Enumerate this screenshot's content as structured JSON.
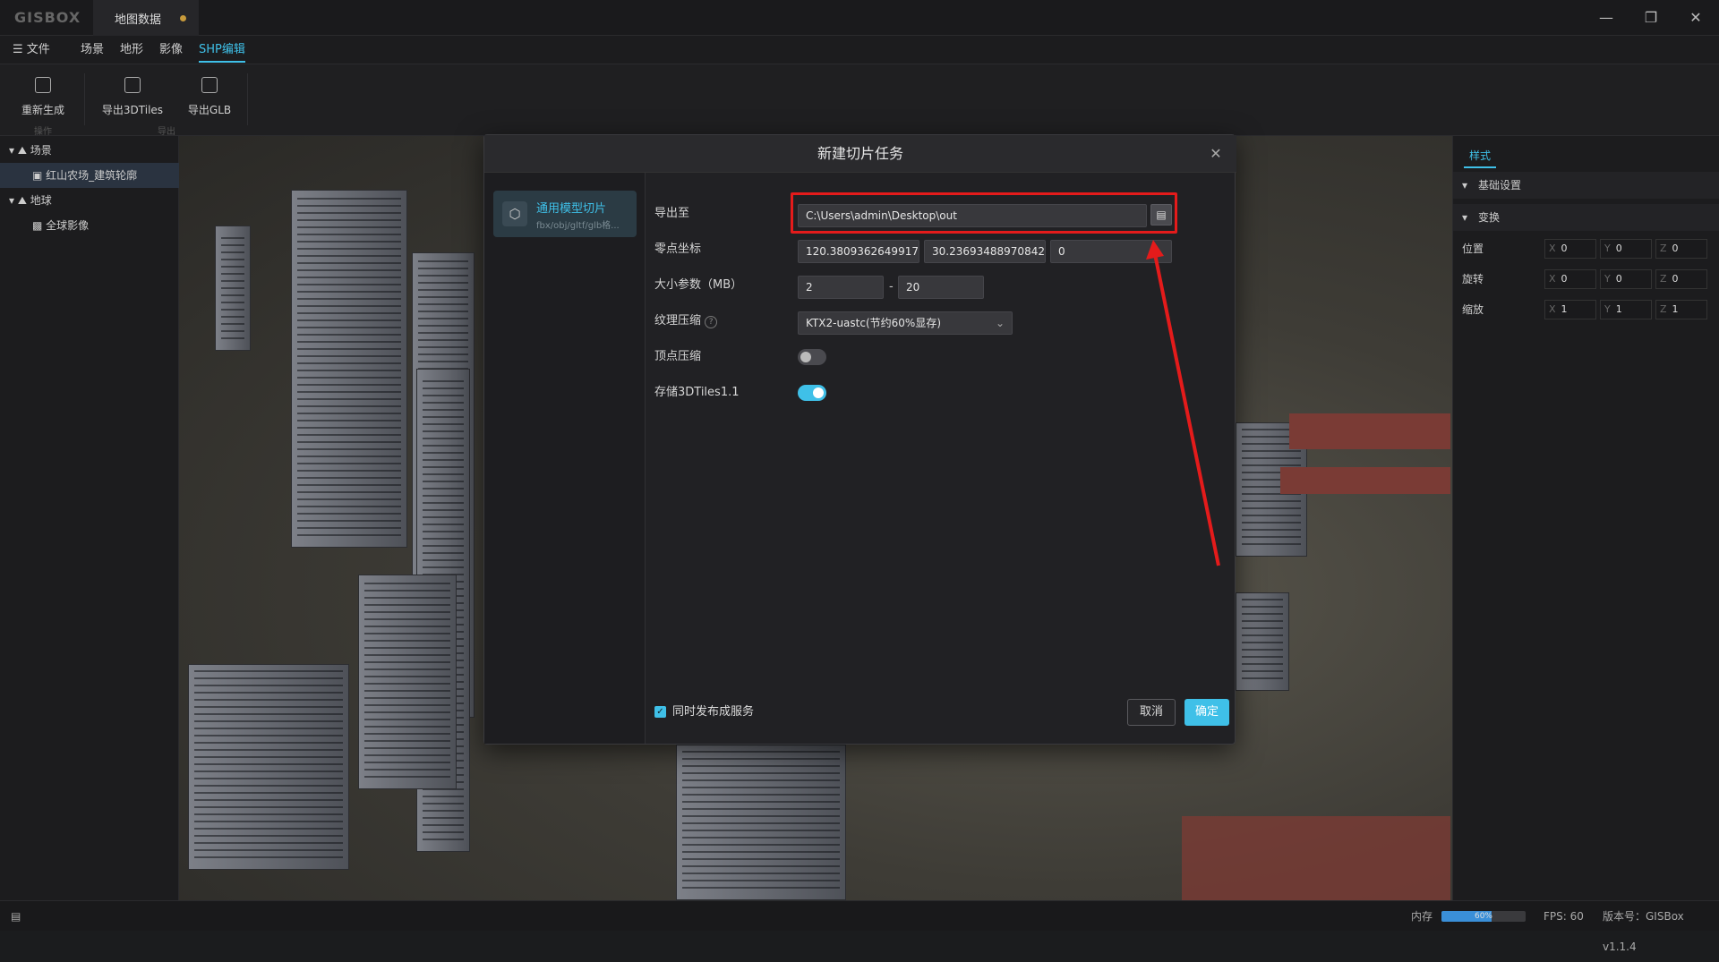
{
  "app": {
    "logo": "GISBOX",
    "tab_title": "地图数据"
  },
  "menu": [
    "文件",
    "场景",
    "地形",
    "影像",
    "SHP编辑"
  ],
  "ribbon": {
    "buttons": [
      "重新生成",
      "导出3DTiles",
      "导出GLB"
    ],
    "groups": [
      "操作",
      "导出"
    ]
  },
  "tree": {
    "scene_label": "场景",
    "scene_item": "红山农场_建筑轮廓",
    "globe_label": "地球",
    "globe_item": "全球影像"
  },
  "right_panel": {
    "tab": "样式",
    "section_basic": "基础设置",
    "section_transform": "变换",
    "rows": [
      {
        "label": "位置",
        "x": "0",
        "y": "0",
        "z": "0"
      },
      {
        "label": "旋转",
        "x": "0",
        "y": "0",
        "z": "0"
      },
      {
        "label": "缩放",
        "x": "1",
        "y": "1",
        "z": "1"
      }
    ],
    "axes": [
      "X",
      "Y",
      "Z"
    ]
  },
  "dialog": {
    "title": "新建切片任务",
    "side_title": "通用模型切片",
    "side_sub": "fbx/obj/gltf/glb格...",
    "fields": {
      "export_label": "导出至",
      "export_path": "C:\\Users\\admin\\Desktop\\out",
      "origin_label": "零点坐标",
      "origin_x": "120.38093626499176",
      "origin_y": "30.23693488970842",
      "origin_z": "0",
      "size_label": "大小参数（MB）",
      "size_min": "2",
      "size_sep": "-",
      "size_max": "20",
      "texture_label": "纹理压缩",
      "texture_value": "KTX2-uastc(节约60%显存)",
      "vertex_label": "顶点压缩",
      "vertex_on": false,
      "store_label": "存储3DTiles1.1",
      "store_on": true
    },
    "publish_label": "同时发布成服务",
    "publish_checked": true,
    "cancel": "取消",
    "ok": "确定"
  },
  "status": {
    "memory_label": "内存",
    "memory_value": "60%",
    "memory_fraction": 0.6,
    "fps": "FPS: 60",
    "version": "版本号：GISBox v1.1.4"
  },
  "colors": {
    "accent": "#3fc0e8",
    "highlight": "#e41b1b"
  }
}
